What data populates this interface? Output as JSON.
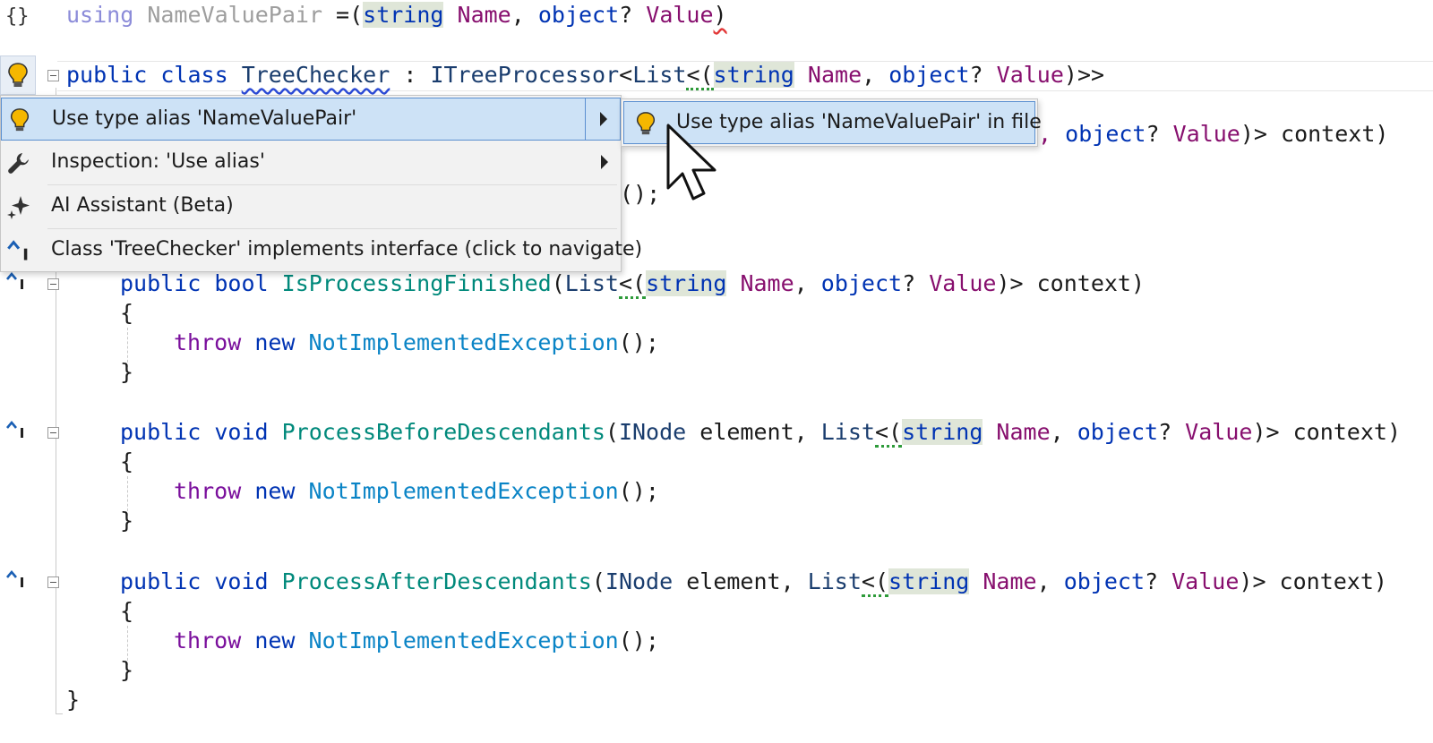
{
  "code": {
    "using_line": {
      "kw": "using",
      "alias": "NameValuePair",
      "eq_paren": " =(",
      "t1": "string",
      "n1": " Name",
      "c1": ", ",
      "t2": "object",
      "q": "? ",
      "n2": "Value",
      "close": ")"
    },
    "class_line": {
      "kw_public": "public",
      "kw_class": "class",
      "name": "TreeChecker",
      "colon": " : ",
      "iface": "ITreeProcessor",
      "lt": "<",
      "list": "List",
      "lt2": "<(",
      "t1": "string",
      "n1": " Name",
      "c1": ", ",
      "t2": "object",
      "q": "? ",
      "n2": "Value",
      "close": ")>>"
    },
    "partial_line1": {
      "tail1": "e,",
      "t2": "object",
      "q": "? ",
      "n2": "Value",
      "close": ")> ",
      "ctx": "context)"
    },
    "partial_line2": "();",
    "method1": {
      "pub": "public",
      "ret": "bool",
      "name": "IsProcessingFinished",
      "open": "(",
      "list": "List",
      "lt": "<(",
      "t1": "string",
      "n1": " Name",
      "c1": ", ",
      "t2": "object",
      "q": "? ",
      "n2": "Value",
      "close": ")> ",
      "ctx": "context)"
    },
    "method2": {
      "pub": "public",
      "ret": "void",
      "name": "ProcessBeforeDescendants",
      "open": "(",
      "ptype": "INode",
      "pname": " element, ",
      "list": "List",
      "lt": "<(",
      "t1": "string",
      "n1": " Name",
      "c1": ", ",
      "t2": "object",
      "q": "? ",
      "n2": "Value",
      "close": ")> ",
      "ctx": "context)"
    },
    "method3": {
      "pub": "public",
      "ret": "void",
      "name": "ProcessAfterDescendants",
      "open": "(",
      "ptype": "INode",
      "pname": " element, ",
      "list": "List",
      "lt": "<(",
      "t1": "string",
      "n1": " Name",
      "c1": ", ",
      "t2": "object",
      "q": "? ",
      "n2": "Value",
      "close": ")> ",
      "ctx": "context)"
    },
    "brace_open": "{",
    "brace_close": "}",
    "throw_kw": "throw",
    "new_kw": "new",
    "exc": "NotImplementedException",
    "exc_tail": "();",
    "class_close": "}"
  },
  "gutter": {
    "namespace_glyph": "{}"
  },
  "context_menu": {
    "items": [
      {
        "label": "Use type alias 'NameValuePair'",
        "icon": "lightbulb-icon",
        "has_submenu": true,
        "selected": true
      },
      {
        "label": "Inspection: 'Use alias'",
        "icon": "wrench-icon",
        "has_submenu": true,
        "selected": false
      },
      {
        "label": "AI Assistant (Beta)",
        "icon": "sparkle-icon",
        "has_submenu": false,
        "selected": false
      },
      {
        "label": "Class 'TreeChecker' implements interface (click to navigate)",
        "icon": "implements-icon",
        "has_submenu": false,
        "selected": false
      }
    ]
  },
  "submenu": {
    "items": [
      {
        "label": "Use type alias 'NameValuePair' in file",
        "icon": "lightbulb-icon",
        "selected": true
      }
    ]
  },
  "colors": {
    "keyword": "#0033b3",
    "control_keyword": "#7a0f9c",
    "method": "#00897b",
    "exception": "#0a84c6",
    "field": "#870f6e",
    "menu_selected": "#cde2f6",
    "menu_bg": "#f2f2f2"
  }
}
